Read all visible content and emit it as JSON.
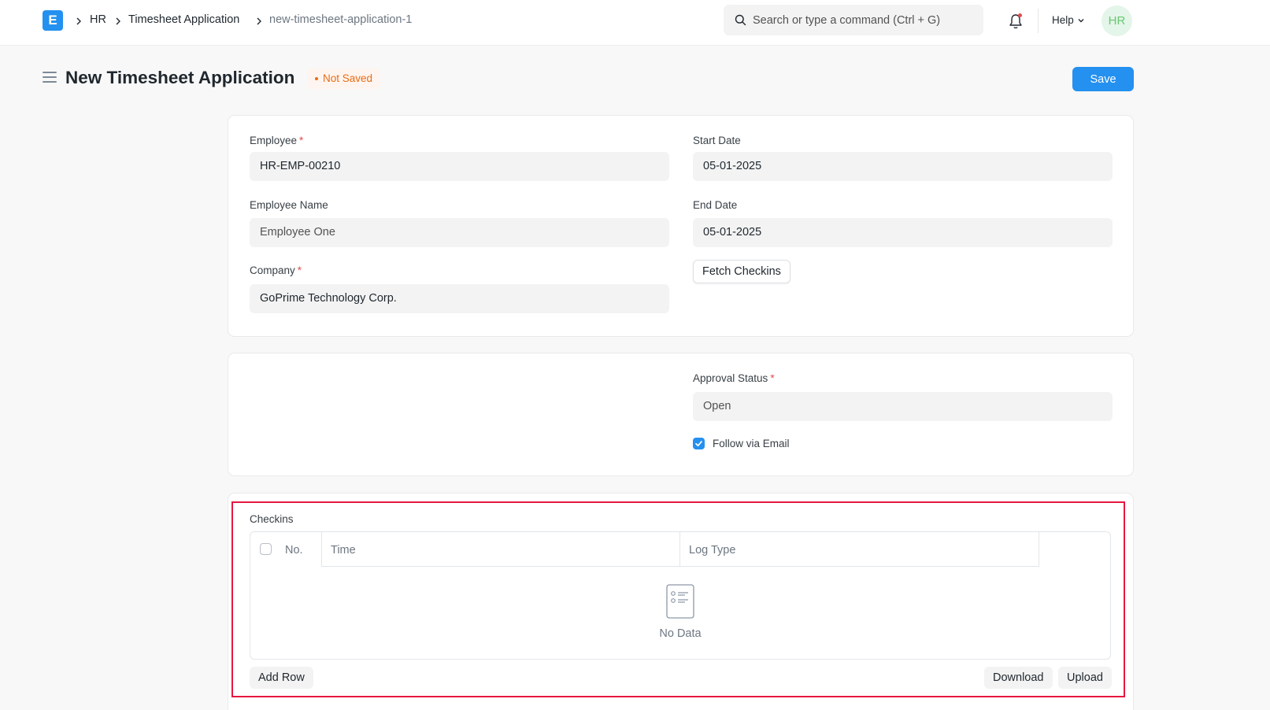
{
  "navbar": {
    "logo_letter": "E",
    "breadcrumbs": [
      "HR",
      "Timesheet Application",
      "new-timesheet-application-1"
    ],
    "search_placeholder": "Search or type a command (Ctrl + G)",
    "help_label": "Help",
    "avatar_initials": "HR"
  },
  "page": {
    "title": "New Timesheet Application",
    "status": "Not Saved",
    "save_label": "Save"
  },
  "form": {
    "employee": {
      "label": "Employee",
      "value": "HR-EMP-00210"
    },
    "employee_name": {
      "label": "Employee Name",
      "value": "Employee One"
    },
    "company": {
      "label": "Company",
      "value": "GoPrime Technology Corp."
    },
    "start_date": {
      "label": "Start Date",
      "value": "05-01-2025"
    },
    "end_date": {
      "label": "End Date",
      "value": "05-01-2025"
    },
    "fetch_label": "Fetch Checkins",
    "approval_status": {
      "label": "Approval Status",
      "value": "Open"
    },
    "follow_label": "Follow via Email",
    "follow_checked": true,
    "required_marker": "*"
  },
  "checkins": {
    "label": "Checkins",
    "columns": [
      "No.",
      "Time",
      "Log Type"
    ],
    "empty_text": "No Data",
    "add_row_label": "Add Row",
    "download_label": "Download",
    "upload_label": "Upload"
  },
  "colors": {
    "primary": "#2490ef",
    "indicator": "#e86c13",
    "highlight": "#e5173f",
    "required": "#e24c4c"
  }
}
